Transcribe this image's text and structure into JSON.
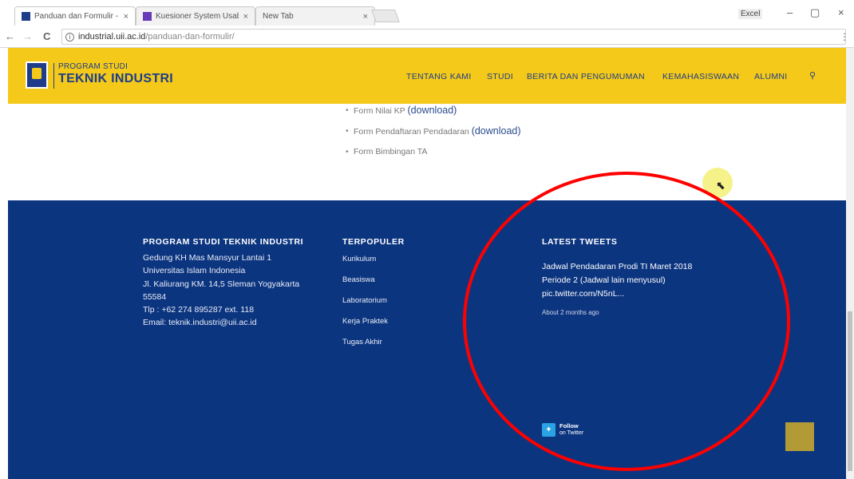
{
  "browser": {
    "tabs": [
      {
        "title": "Panduan dan Formulir - ",
        "close": "×",
        "active": true
      },
      {
        "title": "Kuesioner System Usabil",
        "close": "×",
        "active": false
      },
      {
        "title": "New Tab",
        "close": "×",
        "active": false
      }
    ],
    "user_label": "Excel",
    "window_controls": {
      "minimize": "–",
      "maximize": "▢",
      "close": "×"
    },
    "nav": {
      "back": "←",
      "forward": "→",
      "reload": "C"
    },
    "address": {
      "domain": "industrial.uii.ac.id",
      "path": "/panduan-dan-formulir/",
      "info": "i"
    },
    "menu": "⋮"
  },
  "site": {
    "logo_small": "PROGRAM STUDI",
    "logo_big": "TEKNIK INDUSTRI",
    "nav": [
      "TENTANG KAMI",
      "STUDI",
      "BERITA DAN PENGUMUMAN",
      "KEMAHASISWAAN",
      "ALUMNI"
    ],
    "search_icon": "⚲",
    "colors": {
      "header": "#f4c919",
      "footer": "#0c3580",
      "link": "#2a4c8f"
    }
  },
  "content": {
    "forms": [
      {
        "text": "Form Nilai KP ",
        "link": "(download)"
      },
      {
        "text": "Form Pendaftaran Pendadaran ",
        "link": "(download)"
      },
      {
        "text": "Form Bimbingan TA",
        "link": ""
      }
    ]
  },
  "footer": {
    "col1": {
      "heading": "PROGRAM STUDI TEKNIK INDUSTRI",
      "lines": [
        "Gedung KH Mas Mansyur Lantai 1",
        "Universitas Islam Indonesia",
        "Jl. Kaliurang KM. 14,5 Sleman Yogyakarta",
        "55584",
        "Tlp : +62 274 895287 ext. 118",
        "Email: teknik.industri@uii.ac.id"
      ]
    },
    "col2": {
      "heading": "TERPOPULER",
      "links": [
        "Kurikulum",
        "Beasiswa",
        "Laboratorium",
        "Kerja Praktek",
        "Tugas Akhir"
      ]
    },
    "col3": {
      "heading": "LATEST TWEETS",
      "tweet": "Jadwal Pendadaran Prodi TI Maret 2018 Periode 2 (Jadwal lain menyusul) pic.twitter.com/N5nL...",
      "time": "About 2 months ago",
      "follow_title": "Follow",
      "follow_sub": "on Twitter"
    }
  }
}
